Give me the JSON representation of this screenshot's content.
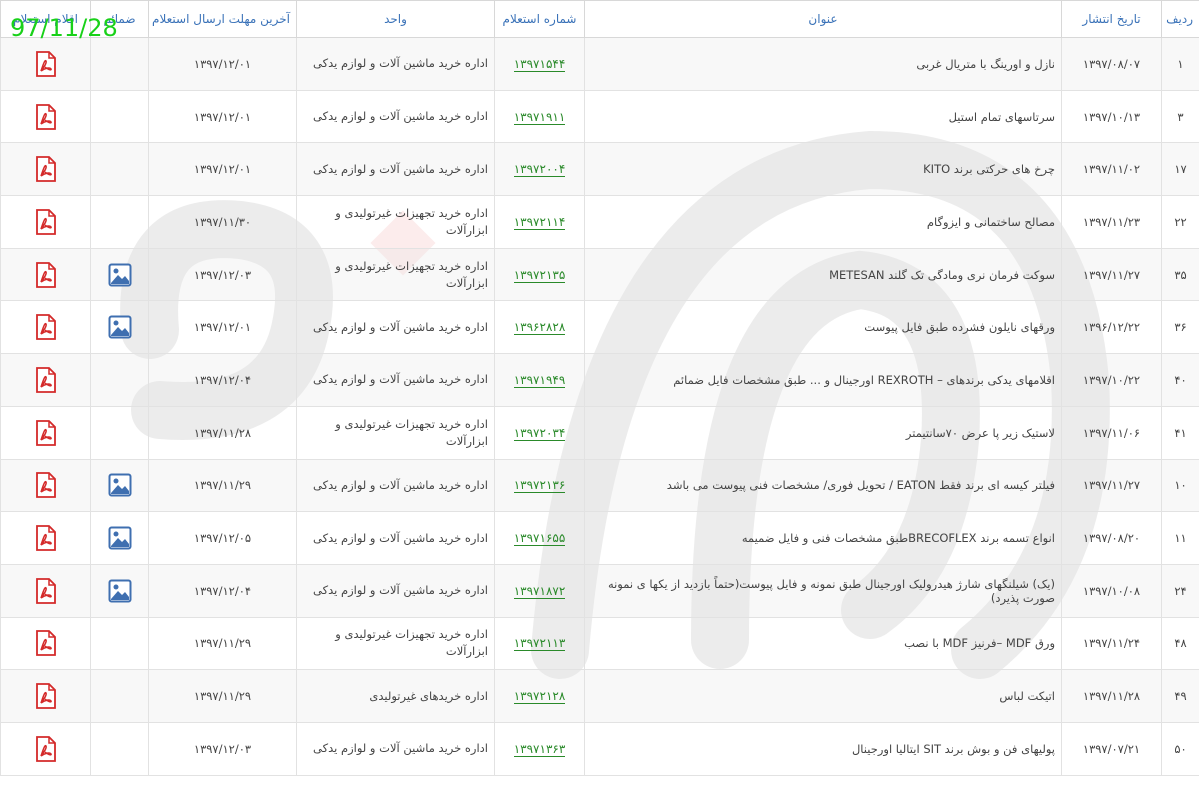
{
  "stamp": "97/11/28",
  "columns": {
    "row": "ردیف",
    "date": "تاریخ انتشار",
    "title": "عنوان",
    "number": "شماره استعلام",
    "unit": "واحد",
    "deadline": "آخرین مهلت ارسال استعلام",
    "attachment": "ضمائم",
    "items": "اقلام استعلام"
  },
  "rows": [
    {
      "row": "۱",
      "date": "۱۳۹۷/۰۸/۰۷",
      "title": "نازل و اورینگ با متریال غربی",
      "number": "۱۳۹۷۱۵۴۴",
      "unit": "اداره خرید ماشین آلات و لوازم یدکی",
      "deadline": "۱۳۹۷/۱۲/۰۱",
      "has_attachment": false
    },
    {
      "row": "۳",
      "date": "۱۳۹۷/۱۰/۱۳",
      "title": "سرتاسهای تمام استیل",
      "number": "۱۳۹۷۱۹۱۱",
      "unit": "اداره خرید ماشین آلات و لوازم یدکی",
      "deadline": "۱۳۹۷/۱۲/۰۱",
      "has_attachment": false
    },
    {
      "row": "۱۷",
      "date": "۱۳۹۷/۱۱/۰۲",
      "title": "چرخ های حرکتی برند KITO",
      "number": "۱۳۹۷۲۰۰۴",
      "unit": "اداره خرید ماشین آلات و لوازم یدکی",
      "deadline": "۱۳۹۷/۱۲/۰۱",
      "has_attachment": false
    },
    {
      "row": "۲۲",
      "date": "۱۳۹۷/۱۱/۲۳",
      "title": "مصالح ساختمانی و ایزوگام",
      "number": "۱۳۹۷۲۱۱۴",
      "unit": "اداره خرید تجهیزات غیرتولیدی و ابزارآلات",
      "deadline": "۱۳۹۷/۱۱/۳۰",
      "has_attachment": false
    },
    {
      "row": "۳۵",
      "date": "۱۳۹۷/۱۱/۲۷",
      "title": "سوکت فرمان نری ومادگی تک گلند METESAN",
      "number": "۱۳۹۷۲۱۳۵",
      "unit": "اداره خرید تجهیزات غیرتولیدی و ابزارآلات",
      "deadline": "۱۳۹۷/۱۲/۰۳",
      "has_attachment": true
    },
    {
      "row": "۳۶",
      "date": "۱۳۹۶/۱۲/۲۲",
      "title": "ورقهای نایلون فشرده طبق فایل پیوست",
      "number": "۱۳۹۶۲۸۲۸",
      "unit": "اداره خرید ماشین آلات و لوازم یدکی",
      "deadline": "۱۳۹۷/۱۲/۰۱",
      "has_attachment": true
    },
    {
      "row": "۴۰",
      "date": "۱۳۹۷/۱۰/۲۲",
      "title": "اقلامهای یدکی برندهای – REXROTH اورجینال و ... طبق مشخصات فایل ضمائم",
      "number": "۱۳۹۷۱۹۴۹",
      "unit": "اداره خرید ماشین آلات و لوازم یدکی",
      "deadline": "۱۳۹۷/۱۲/۰۴",
      "has_attachment": false
    },
    {
      "row": "۴۱",
      "date": "۱۳۹۷/۱۱/۰۶",
      "title": "لاستیک زیر پا عرض ۷۰سانتیمتر",
      "number": "۱۳۹۷۲۰۳۴",
      "unit": "اداره خرید تجهیزات غیرتولیدی و ابزارآلات",
      "deadline": "۱۳۹۷/۱۱/۲۸",
      "has_attachment": false
    },
    {
      "row": "۱۰",
      "date": "۱۳۹۷/۱۱/۲۷",
      "title": "فیلتر کیسه ای برند فقط EATON / تحویل فوری/ مشخصات فنی پیوست می باشد",
      "number": "۱۳۹۷۲۱۳۶",
      "unit": "اداره خرید ماشین آلات و لوازم یدکی",
      "deadline": "۱۳۹۷/۱۱/۲۹",
      "has_attachment": true
    },
    {
      "row": "۱۱",
      "date": "۱۳۹۷/۰۸/۲۰",
      "title": "انواع تسمه برند BRECOFLEXطبق مشخصات فنی و فایل ضمیمه",
      "number": "۱۳۹۷۱۶۵۵",
      "unit": "اداره خرید ماشین آلات و لوازم یدکی",
      "deadline": "۱۳۹۷/۱۲/۰۵",
      "has_attachment": true
    },
    {
      "row": "۲۴",
      "date": "۱۳۹۷/۱۰/۰۸",
      "title": "(یک) شیلنگهای شارژ هیدرولیک اورجینال طبق نمونه و فایل پیوست(حتماً بازدید از یکها ی نمونه صورت پذیرد)",
      "number": "۱۳۹۷۱۸۷۲",
      "unit": "اداره خرید ماشین آلات و لوازم یدکی",
      "deadline": "۱۳۹۷/۱۲/۰۴",
      "has_attachment": true
    },
    {
      "row": "۴۸",
      "date": "۱۳۹۷/۱۱/۲۴",
      "title": "ورق MDF –فرنیز MDF با نصب",
      "number": "۱۳۹۷۲۱۱۳",
      "unit": "اداره خرید تجهیزات غیرتولیدی و ابزارآلات",
      "deadline": "۱۳۹۷/۱۱/۲۹",
      "has_attachment": false
    },
    {
      "row": "۴۹",
      "date": "۱۳۹۷/۱۱/۲۸",
      "title": "اتیکت لباس",
      "number": "۱۳۹۷۲۱۲۸",
      "unit": "اداره خرید‌های غیرتولیدی",
      "deadline": "۱۳۹۷/۱۱/۲۹",
      "has_attachment": false
    },
    {
      "row": "۵۰",
      "date": "۱۳۹۷/۰۷/۲۱",
      "title": "پولیهای فن و بوش برند SIT ایتالیا اورجینال",
      "number": "۱۳۹۷۱۳۶۳",
      "unit": "اداره خرید ماشین آلات و لوازم یدکی",
      "deadline": "۱۳۹۷/۱۲/۰۳",
      "has_attachment": false
    }
  ],
  "icons": {
    "items": "pdf-icon",
    "attachment": "image-file-icon"
  },
  "colors": {
    "header_text": "#3a72b8",
    "number_link": "#2a8a2a",
    "pdf_red": "#d42a2a",
    "attachment_blue": "#3f6fb0",
    "stamp_green": "#19d119"
  }
}
